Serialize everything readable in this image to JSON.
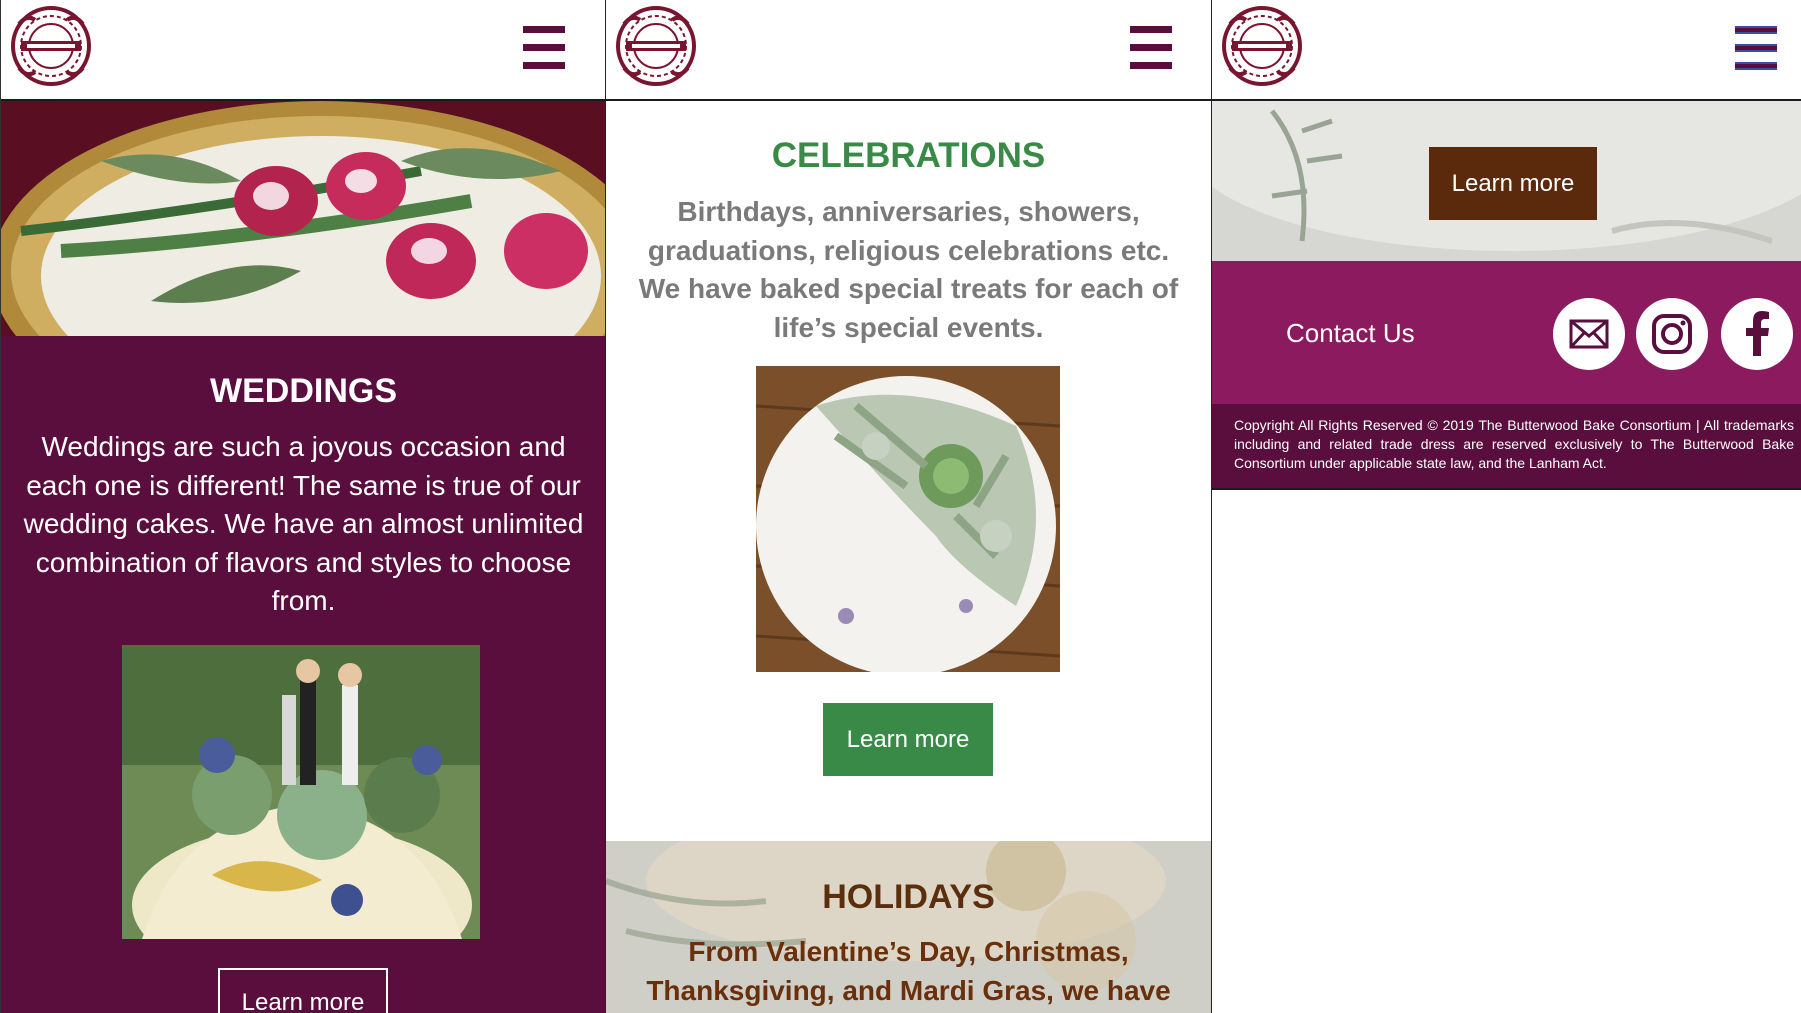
{
  "brand": {
    "logo_icon": "butterwood-bake-logo-icon",
    "colors": {
      "plum": "#5a0e3d",
      "magenta": "#8b1a5f",
      "green": "#3a8a47",
      "brown": "#5b2a0d",
      "gray_text": "#7a7a7a"
    }
  },
  "header": {
    "menu_icon": "hamburger-menu-icon"
  },
  "weddings": {
    "title": "WEDDINGS",
    "text": "Weddings are such a joyous occasion and each one is different! The same is true of our wedding cakes. We have an almost unlimited combination of flavors and styles to choose from.",
    "button_label": "Learn more"
  },
  "celebrations": {
    "title": "CELEBRATIONS",
    "text": "Birthdays, anniversaries, showers, graduations, religious celebrations etc. We have baked special treats for each of life’s special events.",
    "button_label": "Learn more"
  },
  "holidays": {
    "title": "HOLIDAYS",
    "text": "From Valentine’s Day, Christmas, Thanksgiving, and Mardi Gras, we have",
    "button_label": "Learn more"
  },
  "footer": {
    "contact_label": "Contact Us",
    "social_icons": [
      "email-icon",
      "instagram-icon",
      "facebook-icon"
    ],
    "copyright": "Copyright All Rights Reserved © 2019 The Butterwood Bake Consortium | All trademarks including and related trade dress are reserved exclusively to The Butterwood Bake Consortium under applicable state law, and the Lanham Act."
  }
}
